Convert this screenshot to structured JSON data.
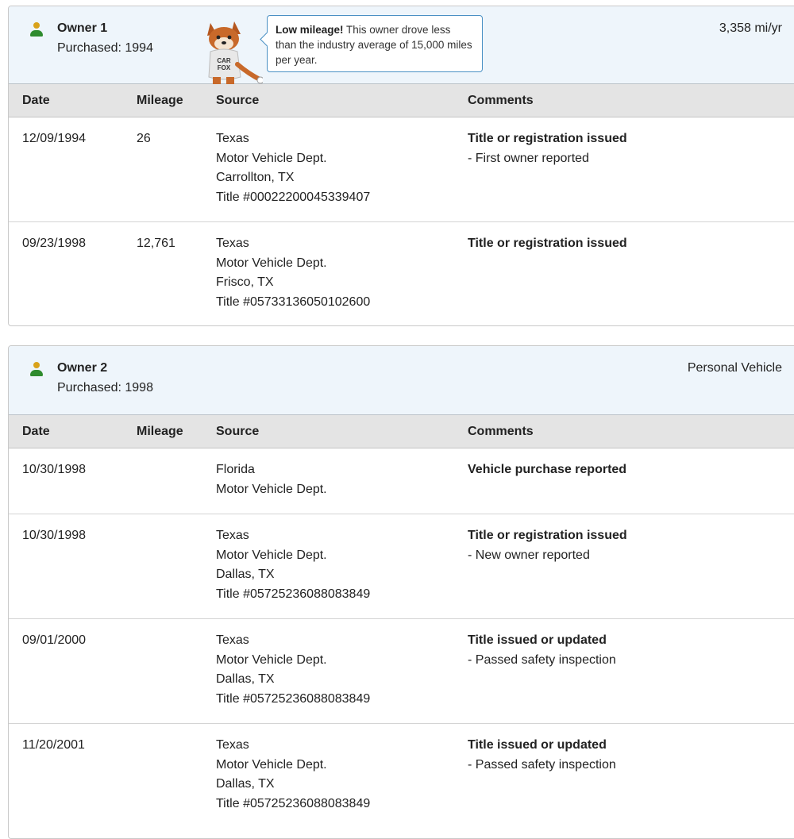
{
  "owners": [
    {
      "name": "Owner 1",
      "purchased": "Purchased: 1994",
      "right_text": "3,358 mi/yr",
      "mascot": {
        "shirt_line1": "CAR",
        "shirt_line2": "FOX"
      },
      "callout": {
        "bold": "Low mileage!",
        "text": " This owner drove less than the industry average of 15,000 miles per year."
      },
      "columns": {
        "date": "Date",
        "mileage": "Mileage",
        "source": "Source",
        "comments": "Comments"
      },
      "rows": [
        {
          "date": "12/09/1994",
          "mileage": "26",
          "source": [
            "Texas",
            "Motor Vehicle Dept.",
            "Carrollton, TX",
            "Title #00022200045339407"
          ],
          "comment_title": "Title or registration issued",
          "comment_detail": "- First owner reported"
        },
        {
          "date": "09/23/1998",
          "mileage": "12,761",
          "source": [
            "Texas",
            "Motor Vehicle Dept.",
            "Frisco, TX",
            "Title #05733136050102600"
          ],
          "comment_title": "Title or registration issued",
          "comment_detail": ""
        }
      ]
    },
    {
      "name": "Owner 2",
      "purchased": "Purchased: 1998",
      "right_text": "Personal Vehicle",
      "columns": {
        "date": "Date",
        "mileage": "Mileage",
        "source": "Source",
        "comments": "Comments"
      },
      "rows": [
        {
          "date": "10/30/1998",
          "mileage": "",
          "source": [
            "Florida",
            "Motor Vehicle Dept.",
            "",
            ""
          ],
          "comment_title": "Vehicle purchase reported",
          "comment_detail": ""
        },
        {
          "date": "10/30/1998",
          "mileage": "",
          "source": [
            "Texas",
            "Motor Vehicle Dept.",
            "Dallas, TX",
            "Title #05725236088083849"
          ],
          "comment_title": "Title or registration issued",
          "comment_detail": "- New owner reported"
        },
        {
          "date": "09/01/2000",
          "mileage": "",
          "source": [
            "Texas",
            "Motor Vehicle Dept.",
            "Dallas, TX",
            "Title #05725236088083849"
          ],
          "comment_title": "Title issued or updated",
          "comment_detail": "- Passed safety inspection"
        },
        {
          "date": "11/20/2001",
          "mileage": "",
          "source": [
            "Texas",
            "Motor Vehicle Dept.",
            "Dallas, TX",
            "Title #05725236088083849"
          ],
          "comment_title": "Title issued or updated",
          "comment_detail": "- Passed safety inspection"
        }
      ]
    }
  ],
  "colors": {
    "accent_blue": "#4a90c4",
    "header_bg": "#eef5fb",
    "table_head_bg": "#e4e4e4",
    "person_body": "#2e8b2e",
    "person_head": "#d9a21b"
  }
}
